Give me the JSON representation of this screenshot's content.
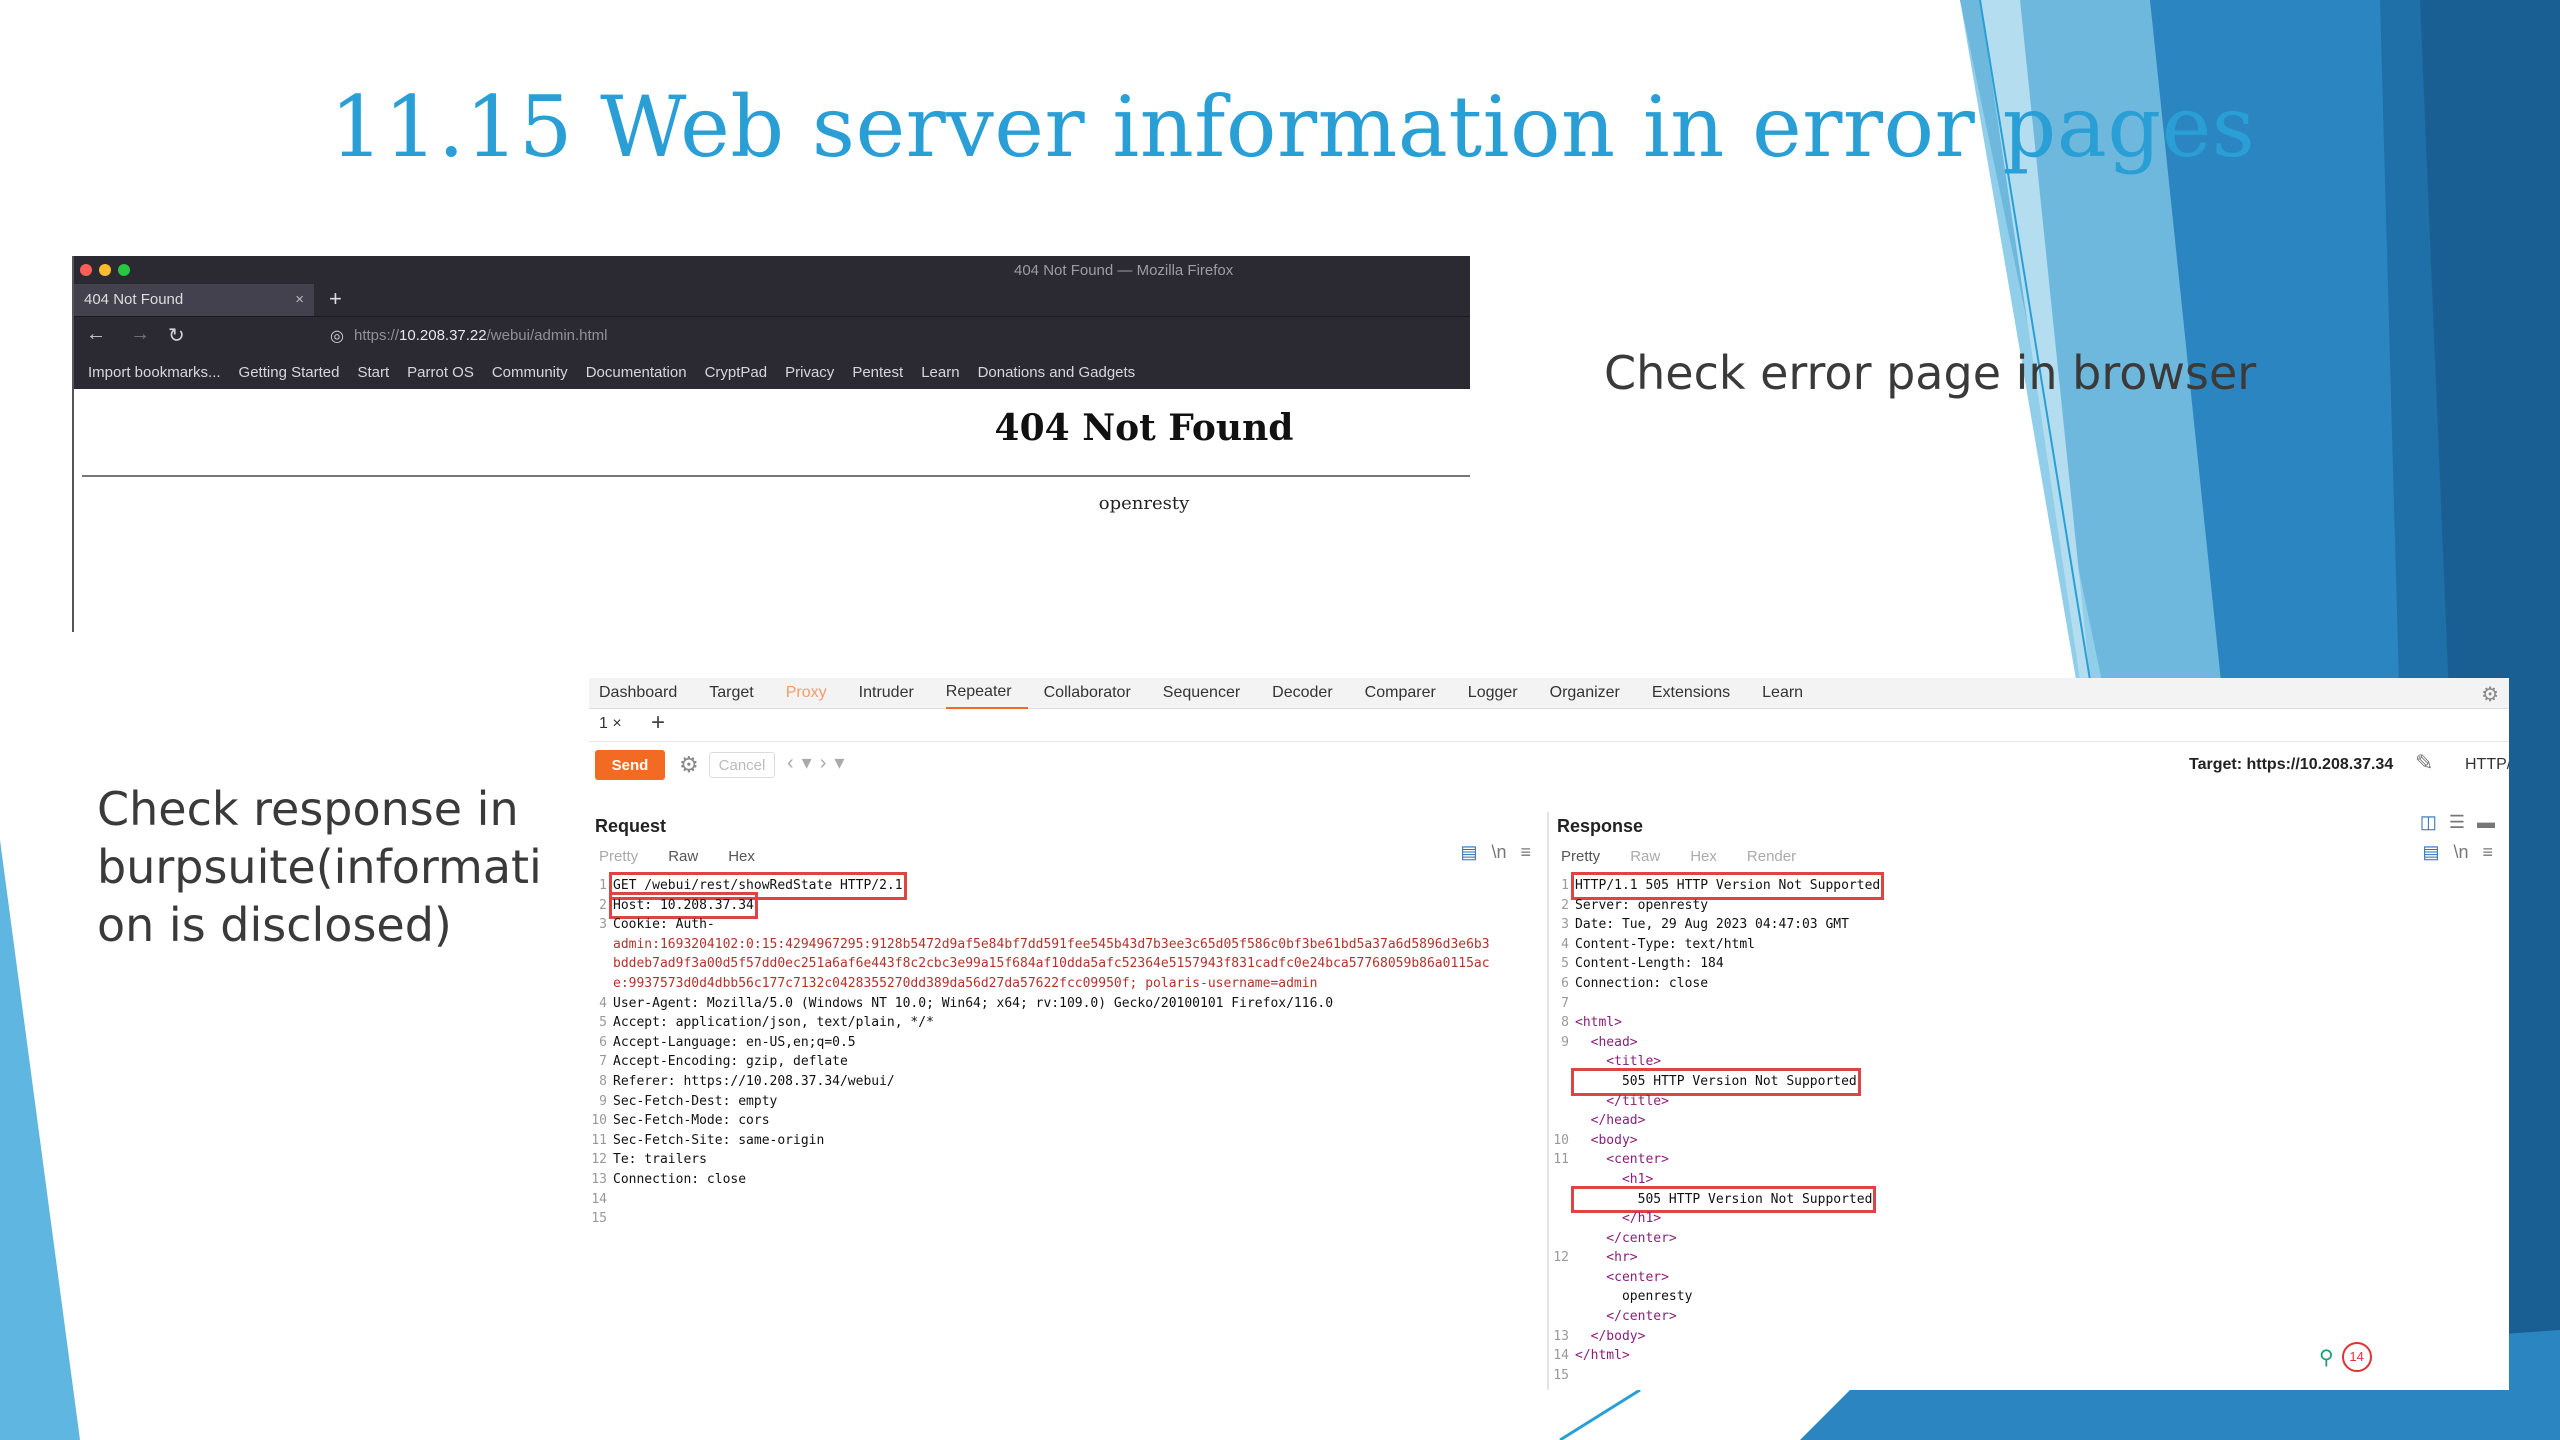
{
  "slide": {
    "title": "11.15 Web server information in error pages",
    "caption_browser": "Check  error page in browser",
    "caption_burp": "Check  response in burpsuite(informati on is disclosed)"
  },
  "browser": {
    "window_title": "404 Not Found — Mozilla Firefox",
    "tab_title": "404 Not Found",
    "tab_close": "×",
    "new_tab": "+",
    "url_prefix": "https://",
    "url_host": "10.208.37.22",
    "url_path": "/webui/admin.html",
    "bookmarks": [
      "Import bookmarks...",
      "Getting Started",
      "Start",
      "Parrot OS",
      "Community",
      "Documentation",
      "CryptPad",
      "Privacy",
      "Pentest",
      "Learn",
      "Donations and Gadgets"
    ],
    "page_heading": "404 Not Found",
    "page_footer": "openresty"
  },
  "burp": {
    "menu": [
      "Dashboard",
      "Target",
      "Proxy",
      "Intruder",
      "Repeater",
      "Collaborator",
      "Sequencer",
      "Decoder",
      "Comparer",
      "Logger",
      "Organizer",
      "Extensions",
      "Learn"
    ],
    "active_menu": "Repeater",
    "repeater_tab": "1 ×",
    "add_tab": "+",
    "send_label": "Send",
    "cancel_label": "Cancel",
    "target_label": "Target: https://10.208.37.34",
    "http_label": "HTTP/",
    "request": {
      "title": "Request",
      "view_tabs": [
        "Pretty",
        "Raw",
        "Hex"
      ],
      "lines": [
        {
          "n": "1",
          "text": "GET /webui/rest/showRedState HTTP/2.1",
          "boxed": true
        },
        {
          "n": "2",
          "text": "Host: 10.208.37.34",
          "boxed": true
        },
        {
          "n": "3",
          "text": "Cookie: Auth-",
          "boxed": false
        },
        {
          "n": "",
          "text": "admin:1693204102:0:15:4294967295:9128b5472d9af5e84bf7dd591fee545b43d7b3ee3c65d05f586c0bf3be61bd5a37a6d5896d3e6b3",
          "boxed": false,
          "cls": "red"
        },
        {
          "n": "",
          "text": "bddeb7ad9f3a00d5f57dd0ec251a6af6e443f8c2cbc3e99a15f684af10dda5afc52364e5157943f831cadfc0e24bca57768059b86a0115ac",
          "boxed": false,
          "cls": "red"
        },
        {
          "n": "",
          "text": "e:9937573d0d4dbb56c177c7132c0428355270dd389da56d27da57622fcc09950f; polaris-username=admin",
          "boxed": false,
          "cls": "red"
        },
        {
          "n": "4",
          "text": "User-Agent: Mozilla/5.0 (Windows NT 10.0; Win64; x64; rv:109.0) Gecko/20100101 Firefox/116.0",
          "boxed": false
        },
        {
          "n": "5",
          "text": "Accept: application/json, text/plain, */*",
          "boxed": false
        },
        {
          "n": "6",
          "text": "Accept-Language: en-US,en;q=0.5",
          "boxed": false
        },
        {
          "n": "7",
          "text": "Accept-Encoding: gzip, deflate",
          "boxed": false
        },
        {
          "n": "8",
          "text": "Referer: https://10.208.37.34/webui/",
          "boxed": false
        },
        {
          "n": "9",
          "text": "Sec-Fetch-Dest: empty",
          "boxed": false
        },
        {
          "n": "10",
          "text": "Sec-Fetch-Mode: cors",
          "boxed": false
        },
        {
          "n": "11",
          "text": "Sec-Fetch-Site: same-origin",
          "boxed": false
        },
        {
          "n": "12",
          "text": "Te: trailers",
          "boxed": false
        },
        {
          "n": "13",
          "text": "Connection: close",
          "boxed": false
        },
        {
          "n": "14",
          "text": "",
          "boxed": false
        },
        {
          "n": "15",
          "text": "",
          "boxed": false
        }
      ]
    },
    "response": {
      "title": "Response",
      "view_tabs": [
        "Pretty",
        "Raw",
        "Hex",
        "Render"
      ],
      "lines": [
        {
          "n": "1",
          "text": "HTTP/1.1 505 HTTP Version Not Supported",
          "boxed": true
        },
        {
          "n": "2",
          "text": "Server: openresty",
          "boxed": false
        },
        {
          "n": "3",
          "text": "Date: Tue, 29 Aug 2023 04:47:03 GMT",
          "boxed": false
        },
        {
          "n": "4",
          "text": "Content-Type: text/html",
          "boxed": false
        },
        {
          "n": "5",
          "text": "Content-Length: 184",
          "boxed": false
        },
        {
          "n": "6",
          "text": "Connection: close",
          "boxed": false
        },
        {
          "n": "7",
          "text": "",
          "boxed": false
        },
        {
          "n": "8",
          "text": "<html>",
          "boxed": false,
          "cls": "tag"
        },
        {
          "n": "9",
          "text": "  <head>",
          "boxed": false,
          "cls": "tag"
        },
        {
          "n": "",
          "text": "    <title>",
          "boxed": false,
          "cls": "tag"
        },
        {
          "n": "",
          "text": "      505 HTTP Version Not Supported",
          "boxed": true
        },
        {
          "n": "",
          "text": "    </title>",
          "boxed": false,
          "cls": "tag"
        },
        {
          "n": "",
          "text": "  </head>",
          "boxed": false,
          "cls": "tag"
        },
        {
          "n": "10",
          "text": "  <body>",
          "boxed": false,
          "cls": "tag"
        },
        {
          "n": "11",
          "text": "    <center>",
          "boxed": false,
          "cls": "tag"
        },
        {
          "n": "",
          "text": "      <h1>",
          "boxed": false,
          "cls": "tag"
        },
        {
          "n": "",
          "text": "        505 HTTP Version Not Supported",
          "boxed": true
        },
        {
          "n": "",
          "text": "      </h1>",
          "boxed": false,
          "cls": "tag"
        },
        {
          "n": "",
          "text": "    </center>",
          "boxed": false,
          "cls": "tag"
        },
        {
          "n": "12",
          "text": "    <hr>",
          "boxed": false,
          "cls": "tag"
        },
        {
          "n": "",
          "text": "    <center>",
          "boxed": false,
          "cls": "tag"
        },
        {
          "n": "",
          "text": "      openresty",
          "boxed": false
        },
        {
          "n": "",
          "text": "    </center>",
          "boxed": false,
          "cls": "tag"
        },
        {
          "n": "13",
          "text": "  </body>",
          "boxed": false,
          "cls": "tag"
        },
        {
          "n": "14",
          "text": "</html>",
          "boxed": false,
          "cls": "tag"
        },
        {
          "n": "15",
          "text": "",
          "boxed": false
        }
      ]
    },
    "badge_count": "14"
  },
  "colors": {
    "title": "#2a9fd6",
    "burp_accent": "#f36b22",
    "highlight_box": "#dd4444",
    "deco_dark": "#1f6fa8",
    "deco_light": "#7cc6e6"
  }
}
